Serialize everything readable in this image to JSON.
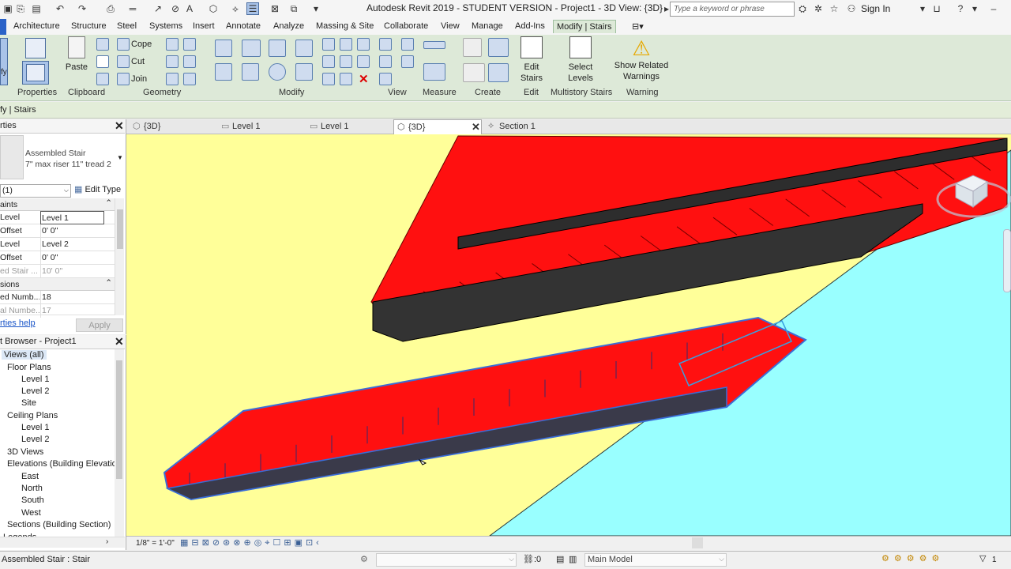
{
  "app_title": "Autodesk Revit 2019 - STUDENT VERSION - Project1 - 3D View: {3D}",
  "search_placeholder": "Type a keyword or phrase",
  "sign_in": "Sign In",
  "ribbon_tabs": [
    "Architecture",
    "Structure",
    "Steel",
    "Systems",
    "Insert",
    "Annotate",
    "Analyze",
    "Massing & Site",
    "Collaborate",
    "View",
    "Manage",
    "Add-Ins",
    "Modify | Stairs"
  ],
  "ribbon": {
    "panels": {
      "properties": "Properties",
      "clipboard": "Clipboard",
      "geometry": "Geometry",
      "modify": "Modify",
      "view": "View",
      "measure": "Measure",
      "create": "Create",
      "edit": "Edit",
      "multistory": "Multistory Stairs",
      "warning": "Warning"
    },
    "buttons": {
      "paste": "Paste",
      "cope": "Cope",
      "cut": "Cut",
      "join": "Join",
      "edit_stairs_1": "Edit",
      "edit_stairs_2": "Stairs",
      "select_levels_1": "Select",
      "select_levels_2": "Levels",
      "show_warnings_1": "Show Related",
      "show_warnings_2": "Warnings",
      "modify_short": "fy"
    }
  },
  "context_bar": "fy | Stairs",
  "view_tabs": [
    "{3D}",
    "Level 1",
    "Level 1",
    "{3D}",
    "Section 1"
  ],
  "properties": {
    "title": "rties",
    "type_name_1": "Assembled Stair",
    "type_name_2": "7\" max riser 11\" tread 2",
    "instance_filter": "(1)",
    "edit_type": "Edit Type",
    "group_constraints": "aints",
    "group_dimensions": "sions",
    "rows": [
      {
        "key": "Level",
        "value": "Level 1"
      },
      {
        "key": "Offset",
        "value": "0'  0\""
      },
      {
        "key": "Level",
        "value": "Level 2"
      },
      {
        "key": "Offset",
        "value": "0'  0\""
      },
      {
        "key": "ed Stair ...",
        "value": "10'  0\""
      }
    ],
    "dim_rows": [
      {
        "key": "ed Numb...",
        "value": "18"
      },
      {
        "key": "al Numbe...",
        "value": "17"
      }
    ],
    "help_link": "rties help",
    "apply": "Apply"
  },
  "browser": {
    "title": "t Browser - Project1",
    "items": [
      {
        "label": "Views (all)",
        "level": 0
      },
      {
        "label": "Floor Plans",
        "level": 1
      },
      {
        "label": "Level 1",
        "level": 2
      },
      {
        "label": "Level 2",
        "level": 2
      },
      {
        "label": "Site",
        "level": 2
      },
      {
        "label": "Ceiling Plans",
        "level": 1
      },
      {
        "label": "Level 1",
        "level": 2
      },
      {
        "label": "Level 2",
        "level": 2
      },
      {
        "label": "3D Views",
        "level": 1
      },
      {
        "label": "Elevations (Building Elevatio",
        "level": 1
      },
      {
        "label": "East",
        "level": 2
      },
      {
        "label": "North",
        "level": 2
      },
      {
        "label": "South",
        "level": 2
      },
      {
        "label": "West",
        "level": 2
      },
      {
        "label": "Sections (Building Section)",
        "level": 1
      },
      {
        "label": "Legends",
        "level": 0
      }
    ]
  },
  "view_control": {
    "scale": "1/8\" = 1'-0\""
  },
  "status": {
    "selection": "Assembled Stair : Stair",
    "zero": ":0",
    "model": "Main Model",
    "filter_count": "1"
  },
  "colors": {
    "ribbon_bg": "#dde9d8",
    "viewport_bg": "#ffff99",
    "ground": "#99ffff",
    "stair_tread": "#ff1010",
    "stringer": "#333333",
    "selection_blue": "#3a6dd8"
  }
}
